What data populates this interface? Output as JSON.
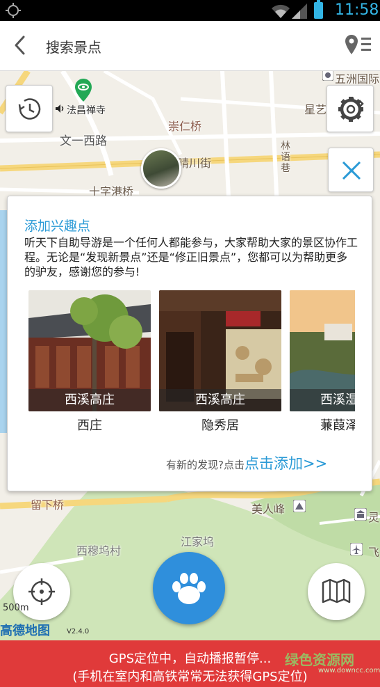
{
  "status_bar": {
    "time": "11:58"
  },
  "header": {
    "title": "搜索景点"
  },
  "map": {
    "labels": {
      "temple": "法昌禅寺",
      "road_wenyi": "文一西路",
      "chongren": "崇仁桥",
      "qingchuan": "晴川街",
      "linxiang": "林语巷",
      "shizigang": "十字港桥",
      "wuzhou": "五洲国际",
      "xingyi": "星艺",
      "liuxia": "留下桥",
      "meirenfeng": "美人峰",
      "ximuwu": "西穆坞村",
      "jiangjiawu": "江家坞",
      "ling": "灵",
      "fei": "飞"
    },
    "scale": "500m",
    "logo": "高德地图",
    "version": "V2.4.0"
  },
  "card": {
    "title": "添加兴趣点",
    "description": "听天下自助导游是一个任何人都能参与，大家帮助大家的景区协作工程。无论是“发现新景点”还是“修正旧景点”，您都可以为帮助更多的驴友，感谢您的参与!",
    "items": [
      {
        "overlay": "西溪高庄",
        "name": "西庄"
      },
      {
        "overlay": "西溪高庄",
        "name": "隐秀居"
      },
      {
        "overlay": "西溪湿",
        "name": "蒹葭泽"
      }
    ],
    "hint": "有新的发现?点击",
    "add_link": "点击添加>>"
  },
  "footer": {
    "line1": "GPS定位中，自动播报暂停...",
    "line2": "(手机在室内和高铁常常无法获得GPS定位)"
  },
  "watermark": {
    "main": "绿色资源网",
    "sub": "www.downcc.com"
  },
  "colors": {
    "accent": "#2a9ad6",
    "paw_button": "#2f8fdc",
    "footer_bg": "#e03a3a",
    "status_icons": "#33b5e5"
  }
}
